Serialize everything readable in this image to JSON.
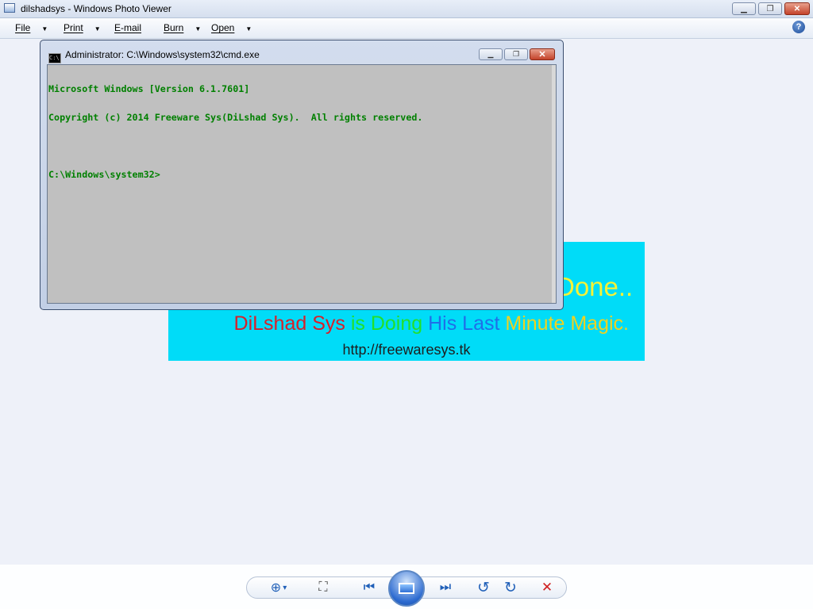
{
  "window": {
    "title": "dilshadsys - Windows Photo Viewer",
    "minimize_glyph": "▁",
    "maximize_glyph": "❐",
    "close_glyph": "✕"
  },
  "menu": {
    "items": [
      {
        "label": "File"
      },
      {
        "label": "Print"
      },
      {
        "label": "E-mail"
      },
      {
        "label": "Burn"
      },
      {
        "label": "Open"
      }
    ],
    "caret": "▼",
    "help_glyph": "?"
  },
  "photo": {
    "line1_visible": "Done..",
    "line2_parts": [
      {
        "text": "DiLshad Sys",
        "color": "#d8202a"
      },
      {
        "text": " is Doing ",
        "color": "#22e02a"
      },
      {
        "text": "His Last ",
        "color": "#1f6fe8"
      },
      {
        "text": "Minute Magic.",
        "color": "#f0d220"
      }
    ],
    "url": "http://freewaresys.tk",
    "background": "#00dcf8"
  },
  "cmd": {
    "title": "Administrator: C:\\Windows\\system32\\cmd.exe",
    "icon_text": "C:\\",
    "lines": [
      "Microsoft Windows [Version 6.1.7601]",
      "Copyright (c) 2014 Freeware Sys(DiLshad Sys).  All rights reserved.",
      "",
      "C:\\Windows\\system32>"
    ],
    "text_color": "#008000",
    "background": "#c0c0c0"
  },
  "controls": {
    "zoom_glyph": "⊕",
    "zoom_caret": "▾",
    "fit_glyph": "⛶",
    "previous_glyph": "⏮",
    "next_glyph": "⏭",
    "rotate_ccw_glyph": "↺",
    "rotate_cw_glyph": "↻",
    "delete_glyph": "✕"
  }
}
